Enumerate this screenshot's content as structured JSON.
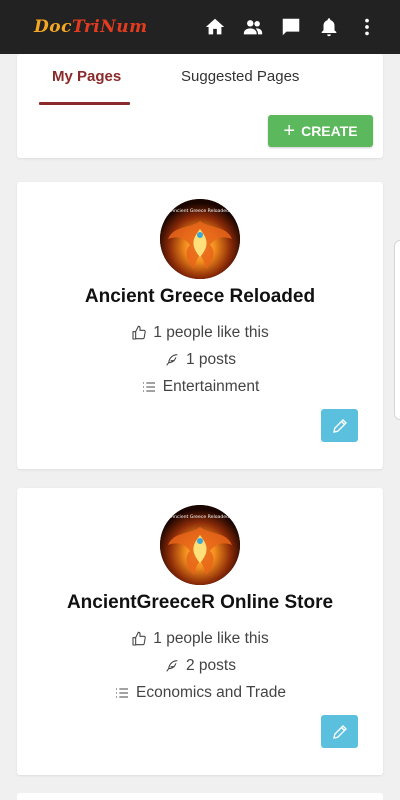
{
  "header": {
    "logo_part1": "Doc",
    "logo_part2": "TriNum",
    "icons": [
      "home-icon",
      "people-icon",
      "chat-icon",
      "bell-icon",
      "more-vert-icon"
    ]
  },
  "tabs": {
    "my_pages": "My Pages",
    "suggested_pages": "Suggested Pages",
    "active": "My Pages"
  },
  "create_button": {
    "label": "CREATE",
    "color": "#5cb85c"
  },
  "pages": [
    {
      "name": "Ancient Greece Reloaded",
      "likes": "1 people like this",
      "posts": "1 posts",
      "category": "Entertainment",
      "avatar_caption": "Ancient Greece Reloaded"
    },
    {
      "name": "AncientGreeceR Online Store",
      "likes": "1 people like this",
      "posts": "2 posts",
      "category": "Economics and Trade",
      "avatar_caption": "Ancient Greece Reloaded"
    }
  ],
  "colors": {
    "topbar": "#222222",
    "accent": "#8b2a2a",
    "edit_button": "#5bc0de"
  }
}
